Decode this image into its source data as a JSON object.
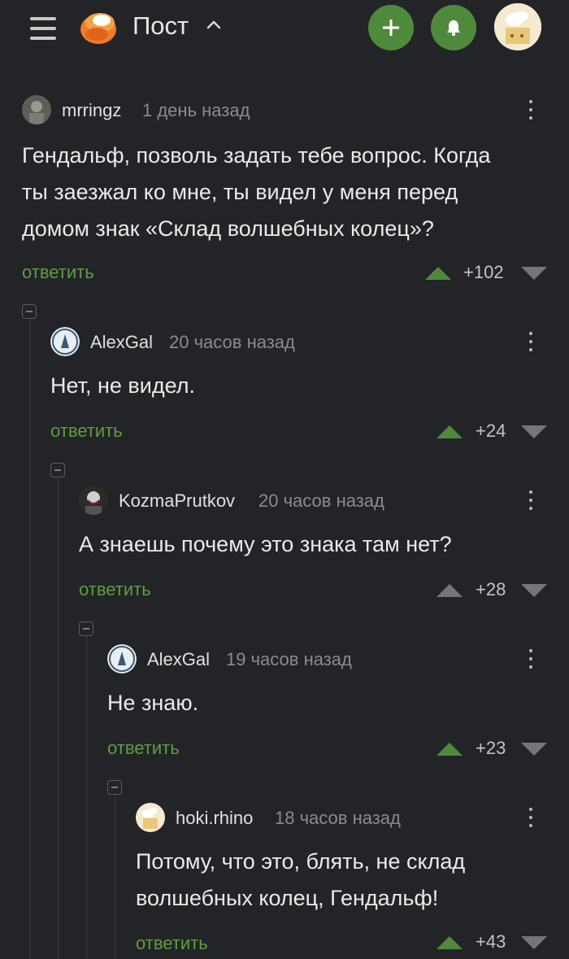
{
  "header": {
    "title": "Пост",
    "menu_icon": "hamburger-icon",
    "logo_icon": "pikabu-logo",
    "add_icon": "plus-icon",
    "notify_icon": "bell-icon",
    "accent_color": "#4f8a3c"
  },
  "comments": [
    {
      "user": "mrringz",
      "time": "1 день назад",
      "text_lines": [
        "Гендальф, позволь задать тебе вопрос. Когда",
        "ты заезжал ко мне, ты видел у меня перед",
        "домом знак «Склад волшебных колец»?"
      ],
      "reply": "ответить",
      "rating": "+102",
      "upvoted": true
    },
    {
      "user": "AlexGal",
      "time": "20 часов назад",
      "text_lines": [
        "Нет, не видел."
      ],
      "reply": "ответить",
      "rating": "+24",
      "upvoted": true
    },
    {
      "user": "KozmaPrutkov",
      "time": "20 часов назад",
      "text_lines": [
        "А знаешь почему это знака там нет?"
      ],
      "reply": "ответить",
      "rating": "+28",
      "upvoted": false
    },
    {
      "user": "AlexGal",
      "time": "19 часов назад",
      "text_lines": [
        "Не знаю."
      ],
      "reply": "ответить",
      "rating": "+23",
      "upvoted": true
    },
    {
      "user": "hoki.rhino",
      "time": "18 часов назад",
      "text_lines": [
        "Потому, что это, блять, не склад",
        "волшебных колец, Гендальф!"
      ],
      "reply": "ответить",
      "rating": "+43",
      "upvoted": true
    }
  ]
}
